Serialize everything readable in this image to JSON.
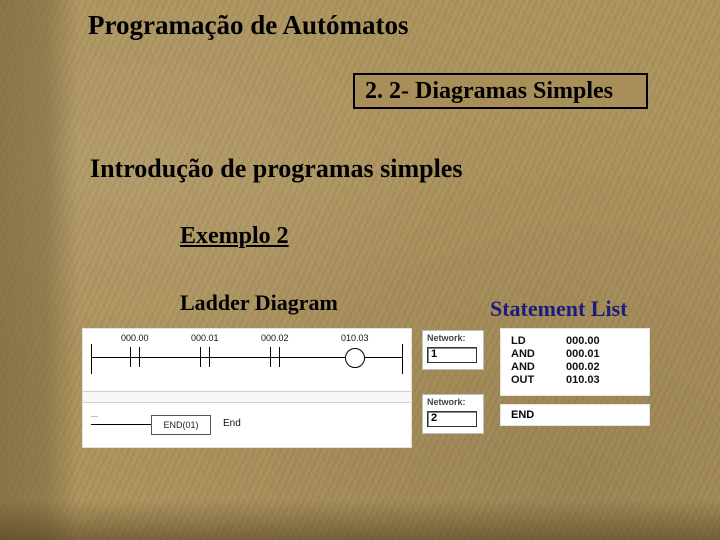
{
  "title": "Programação de Autómatos",
  "section_banner": "2. 2- Diagramas Simples",
  "intro": "Introdução de programas simples",
  "example_label": "Exemplo 2",
  "columns": {
    "ladder_title": "Ladder Diagram",
    "stl_title": "Statement List"
  },
  "ladder": {
    "addresses": [
      "000.00",
      "000.01",
      "000.02",
      "010.03"
    ],
    "end_box": "END(01)",
    "end_label": "End"
  },
  "networks": [
    {
      "label": "Network:",
      "num": "1"
    },
    {
      "label": "Network:",
      "num": "2"
    }
  ],
  "stl_block1": [
    {
      "op": "LD",
      "addr": "000.00"
    },
    {
      "op": "AND",
      "addr": "000.01"
    },
    {
      "op": "AND",
      "addr": "000.02"
    },
    {
      "op": "OUT",
      "addr": "010.03"
    }
  ],
  "stl_block2": "END"
}
